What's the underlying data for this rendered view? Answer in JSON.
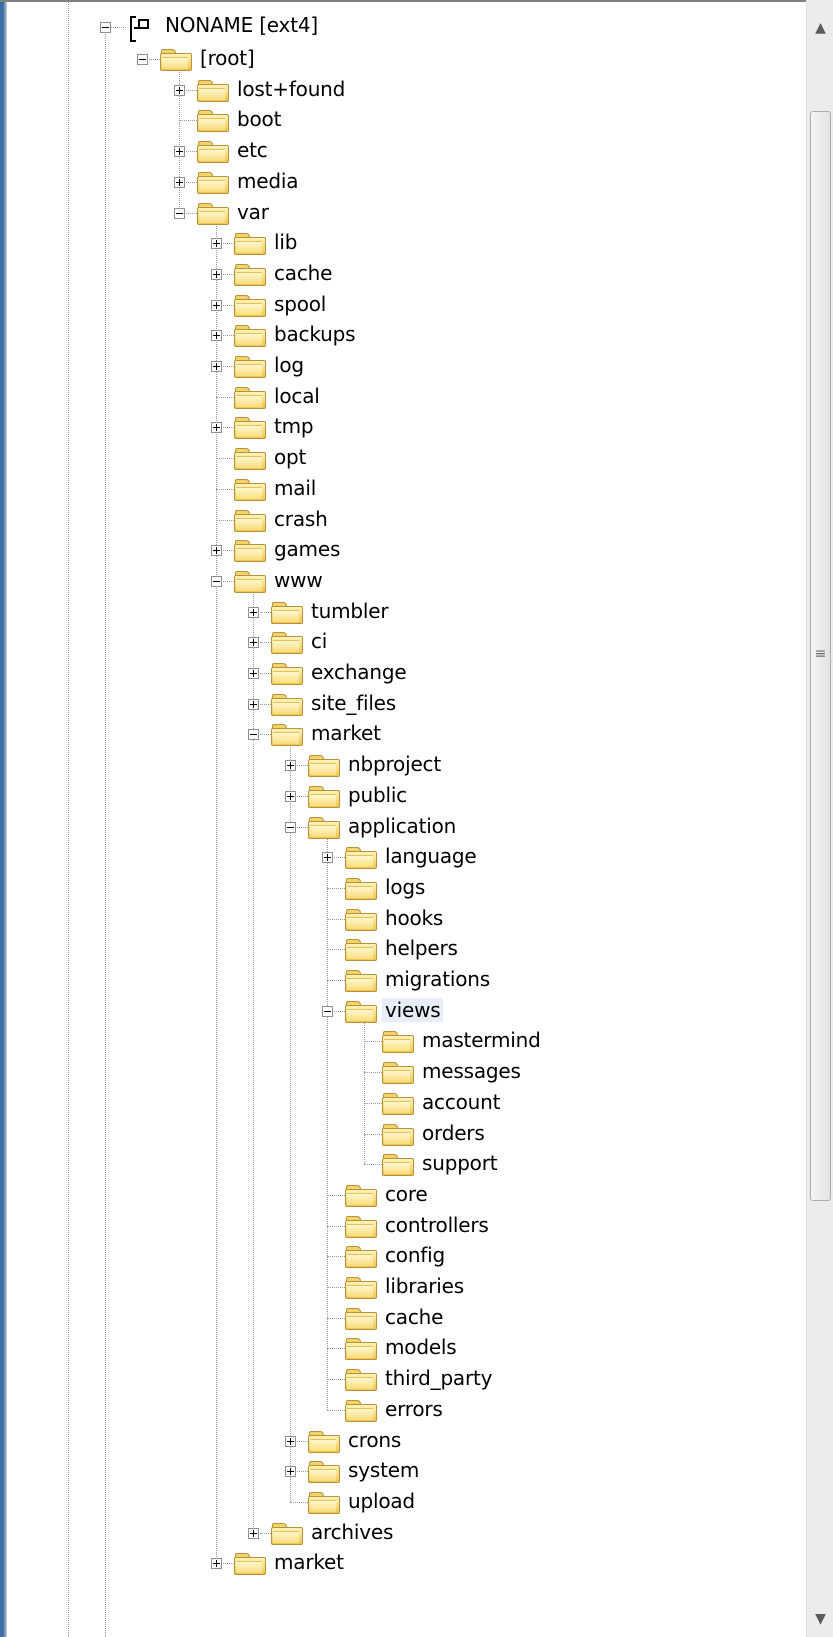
{
  "tree": {
    "root_label": "NONAME [ext4]",
    "items": [
      {
        "label": "[root]",
        "depth": 1,
        "expander": "minus"
      },
      {
        "label": "lost+found",
        "depth": 2,
        "expander": "plus"
      },
      {
        "label": "boot",
        "depth": 2,
        "expander": "none"
      },
      {
        "label": "etc",
        "depth": 2,
        "expander": "plus"
      },
      {
        "label": "media",
        "depth": 2,
        "expander": "plus"
      },
      {
        "label": "var",
        "depth": 2,
        "expander": "minus"
      },
      {
        "label": "lib",
        "depth": 3,
        "expander": "plus"
      },
      {
        "label": "cache",
        "depth": 3,
        "expander": "plus"
      },
      {
        "label": "spool",
        "depth": 3,
        "expander": "plus"
      },
      {
        "label": "backups",
        "depth": 3,
        "expander": "plus"
      },
      {
        "label": "log",
        "depth": 3,
        "expander": "plus"
      },
      {
        "label": "local",
        "depth": 3,
        "expander": "none"
      },
      {
        "label": "tmp",
        "depth": 3,
        "expander": "plus"
      },
      {
        "label": "opt",
        "depth": 3,
        "expander": "none"
      },
      {
        "label": "mail",
        "depth": 3,
        "expander": "none"
      },
      {
        "label": "crash",
        "depth": 3,
        "expander": "none"
      },
      {
        "label": "games",
        "depth": 3,
        "expander": "plus"
      },
      {
        "label": "www",
        "depth": 3,
        "expander": "minus"
      },
      {
        "label": "tumbler",
        "depth": 4,
        "expander": "plus"
      },
      {
        "label": "ci",
        "depth": 4,
        "expander": "plus"
      },
      {
        "label": "exchange",
        "depth": 4,
        "expander": "plus"
      },
      {
        "label": "site_files",
        "depth": 4,
        "expander": "plus"
      },
      {
        "label": "market",
        "depth": 4,
        "expander": "minus"
      },
      {
        "label": "nbproject",
        "depth": 5,
        "expander": "plus"
      },
      {
        "label": "public",
        "depth": 5,
        "expander": "plus"
      },
      {
        "label": "application",
        "depth": 5,
        "expander": "minus"
      },
      {
        "label": "language",
        "depth": 6,
        "expander": "plus"
      },
      {
        "label": "logs",
        "depth": 6,
        "expander": "none"
      },
      {
        "label": "hooks",
        "depth": 6,
        "expander": "none"
      },
      {
        "label": "helpers",
        "depth": 6,
        "expander": "none"
      },
      {
        "label": "migrations",
        "depth": 6,
        "expander": "none"
      },
      {
        "label": "views",
        "depth": 6,
        "expander": "minus",
        "highlighted": true
      },
      {
        "label": "mastermind",
        "depth": 7,
        "expander": "none"
      },
      {
        "label": "messages",
        "depth": 7,
        "expander": "none"
      },
      {
        "label": "account",
        "depth": 7,
        "expander": "none"
      },
      {
        "label": "orders",
        "depth": 7,
        "expander": "none"
      },
      {
        "label": "support",
        "depth": 7,
        "expander": "none"
      },
      {
        "label": "core",
        "depth": 6,
        "expander": "none"
      },
      {
        "label": "controllers",
        "depth": 6,
        "expander": "none"
      },
      {
        "label": "config",
        "depth": 6,
        "expander": "none"
      },
      {
        "label": "libraries",
        "depth": 6,
        "expander": "none"
      },
      {
        "label": "cache",
        "depth": 6,
        "expander": "none"
      },
      {
        "label": "models",
        "depth": 6,
        "expander": "none"
      },
      {
        "label": "third_party",
        "depth": 6,
        "expander": "none"
      },
      {
        "label": "errors",
        "depth": 6,
        "expander": "none"
      },
      {
        "label": "crons",
        "depth": 5,
        "expander": "plus"
      },
      {
        "label": "system",
        "depth": 5,
        "expander": "plus"
      },
      {
        "label": "upload",
        "depth": 5,
        "expander": "none"
      },
      {
        "label": "archives",
        "depth": 4,
        "expander": "plus"
      },
      {
        "label": "market",
        "depth": 3,
        "expander": "plus"
      }
    ]
  },
  "scrollbar": {
    "up_icon": "scroll-up-arrow-icon",
    "down_icon": "scroll-down-arrow-icon",
    "grip_icon": "scroll-grip-icon"
  },
  "icons": {
    "folder": "folder-icon",
    "device": "filesystem-device-icon",
    "expand": "plus-box-icon",
    "collapse": "minus-box-icon"
  },
  "colors": {
    "folder_yellow": "#f9dd7d",
    "highlight": "#e8eef7",
    "guide_line": "#9a9a9a"
  }
}
